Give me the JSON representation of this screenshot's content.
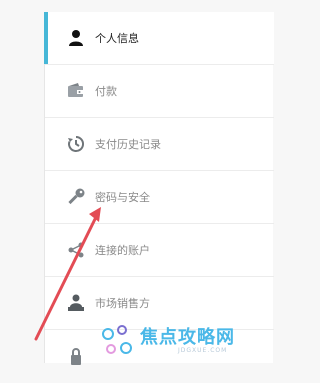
{
  "colors": {
    "active_accent": "#46b7d7",
    "arrow": "#e34c55",
    "watermark": "#4ab8e8"
  },
  "menu": {
    "items": [
      {
        "label": "个人信息",
        "icon": "user-icon",
        "active": true
      },
      {
        "label": "付款",
        "icon": "wallet-icon",
        "active": false
      },
      {
        "label": "支付历史记录",
        "icon": "history-icon",
        "active": false
      },
      {
        "label": "密码与安全",
        "icon": "key-icon",
        "active": false
      },
      {
        "label": "连接的账户",
        "icon": "share-icon",
        "active": false
      },
      {
        "label": "市场销售方",
        "icon": "seller-icon",
        "active": false
      },
      {
        "label": "",
        "icon": "lock-icon",
        "active": false
      }
    ]
  },
  "watermark": {
    "text": "焦点攻略网",
    "subtext": "JDGXUE.COM"
  }
}
